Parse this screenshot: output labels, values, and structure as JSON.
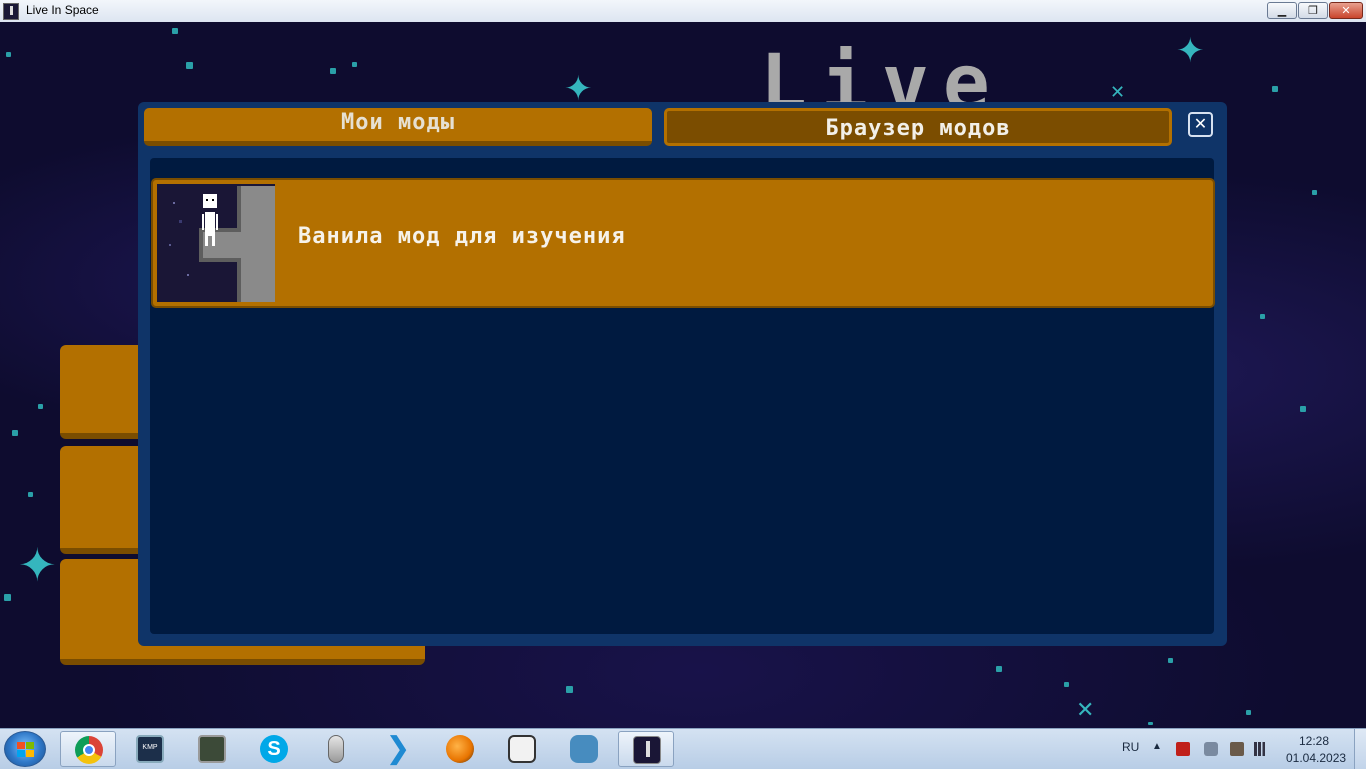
{
  "window": {
    "title": "Live In Space",
    "buttons": {
      "minimize": "▁",
      "maximize": "❐",
      "close": "✕"
    }
  },
  "game": {
    "logo_text": "Live",
    "colors": {
      "accent_orange": "#b37000",
      "dark_orange": "#7a4d00",
      "modal_blue": "#0f3468",
      "inner_blue": "#001a40"
    }
  },
  "modal": {
    "tabs": [
      {
        "label": "Мои моды",
        "selected": true
      },
      {
        "label": "Браузер модов",
        "selected": false
      }
    ],
    "close_icon": "close-icon",
    "mods": [
      {
        "title": "Ванила мод для изучения",
        "thumbnail_icon": "astronaut-icon"
      }
    ]
  },
  "taskbar": {
    "start_icon": "windows-start-icon",
    "apps": [
      {
        "name": "chrome-icon",
        "active": true
      },
      {
        "name": "kmplayer-icon",
        "active": false
      },
      {
        "name": "monitor-app-icon",
        "active": false
      },
      {
        "name": "skype-icon",
        "active": false
      },
      {
        "name": "mouse-app-icon",
        "active": false
      },
      {
        "name": "vscode-icon",
        "active": false
      },
      {
        "name": "fl-studio-icon",
        "active": false
      },
      {
        "name": "ghost-app-icon",
        "active": false
      },
      {
        "name": "godot-icon",
        "active": false
      },
      {
        "name": "live-in-space-icon",
        "active": true
      }
    ],
    "language": "RU",
    "time": "12:28",
    "date": "01.04.2023"
  }
}
